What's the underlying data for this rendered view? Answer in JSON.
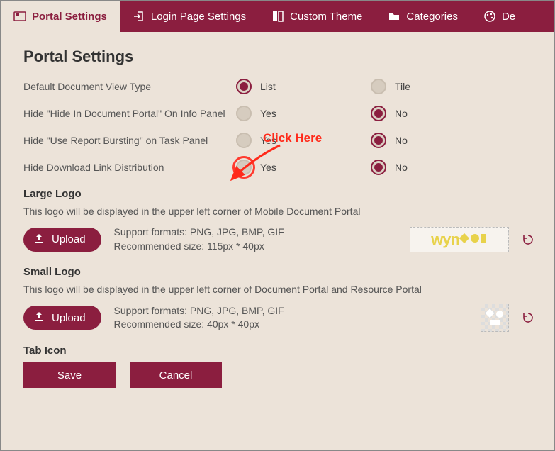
{
  "tabs": [
    {
      "label": "Portal Settings",
      "icon": "portal"
    },
    {
      "label": "Login Page Settings",
      "icon": "login"
    },
    {
      "label": "Custom Theme",
      "icon": "theme"
    },
    {
      "label": "Categories",
      "icon": "folder"
    },
    {
      "label": "De",
      "icon": "palette"
    }
  ],
  "page_title": "Portal Settings",
  "rows": [
    {
      "label": "Default Document View Type",
      "a": "List",
      "b": "Tile",
      "sel": "a"
    },
    {
      "label": "Hide \"Hide In Document Portal\" On Info Panel",
      "a": "Yes",
      "b": "No",
      "sel": "b"
    },
    {
      "label": "Hide \"Use Report Bursting\" on Task Panel",
      "a": "Yes",
      "b": "No",
      "sel": "b"
    },
    {
      "label": "Hide Download Link Distribution",
      "a": "Yes",
      "b": "No",
      "sel": "b",
      "highlight_a": true
    }
  ],
  "large_logo": {
    "heading": "Large Logo",
    "desc": "This logo will be displayed in the upper left corner of Mobile Document Portal",
    "formats": "Support formats: PNG, JPG, BMP, GIF",
    "size": "Recommended size: 115px * 40px",
    "upload": "Upload"
  },
  "small_logo": {
    "heading": "Small Logo",
    "desc": "This logo will be displayed in the upper left corner of Document Portal and Resource Portal",
    "formats": "Support formats: PNG, JPG, BMP, GIF",
    "size": "Recommended size: 40px * 40px",
    "upload": "Upload"
  },
  "tab_icon_heading": "Tab Icon",
  "buttons": {
    "save": "Save",
    "cancel": "Cancel"
  },
  "annotation": "Click Here",
  "logo_text": "wyn"
}
